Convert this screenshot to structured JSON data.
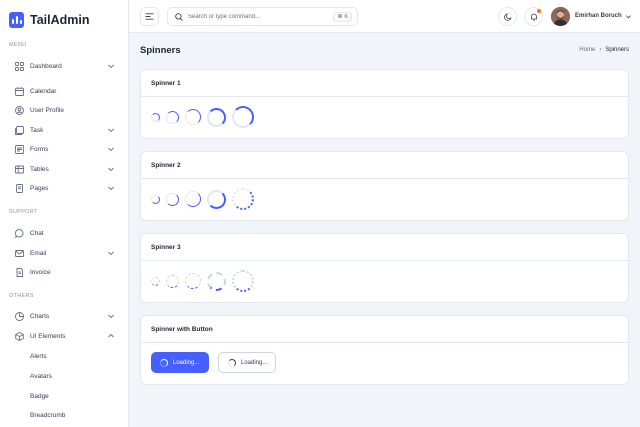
{
  "app": {
    "name": "TailAdmin",
    "brand_color": "#465fff"
  },
  "sidebar": {
    "sections": {
      "menu": "MENU",
      "support": "SUPPORT",
      "others": "OTHERS"
    },
    "menu_items": [
      {
        "label": "Dashboard",
        "icon": "grid-icon"
      },
      {
        "label": "Calendar",
        "icon": "calendar-icon"
      },
      {
        "label": "User Profile",
        "icon": "user-circle-icon"
      },
      {
        "label": "Task",
        "icon": "task-icon"
      },
      {
        "label": "Forms",
        "icon": "forms-icon"
      },
      {
        "label": "Tables",
        "icon": "table-icon"
      },
      {
        "label": "Pages",
        "icon": "pages-icon"
      }
    ],
    "support_items": [
      {
        "label": "Chat",
        "icon": "chat-icon"
      },
      {
        "label": "Email",
        "icon": "mail-icon"
      },
      {
        "label": "Invoice",
        "icon": "invoice-icon"
      }
    ],
    "others_items": [
      {
        "label": "Charts",
        "icon": "pie-chart-icon"
      },
      {
        "label": "UI Elements",
        "icon": "box-icon"
      }
    ],
    "ui_sub_items": [
      "Alerts",
      "Avatars",
      "Badge",
      "Breadcrumb"
    ]
  },
  "header": {
    "search_placeholder": "Search or type command...",
    "search_shortcut": "⌘ K",
    "user_name": "Emirhan Boruch"
  },
  "page": {
    "title": "Spinners",
    "breadcrumb": {
      "home": "Home",
      "separator": "›",
      "current": "Spinners"
    }
  },
  "cards": [
    {
      "title": "Spinner 1"
    },
    {
      "title": "Spinner 2"
    },
    {
      "title": "Spinner 3"
    },
    {
      "title": "Spinner with Button"
    }
  ],
  "buttons": {
    "primary_label": "Loading...",
    "outline_label": "Loading..."
  }
}
